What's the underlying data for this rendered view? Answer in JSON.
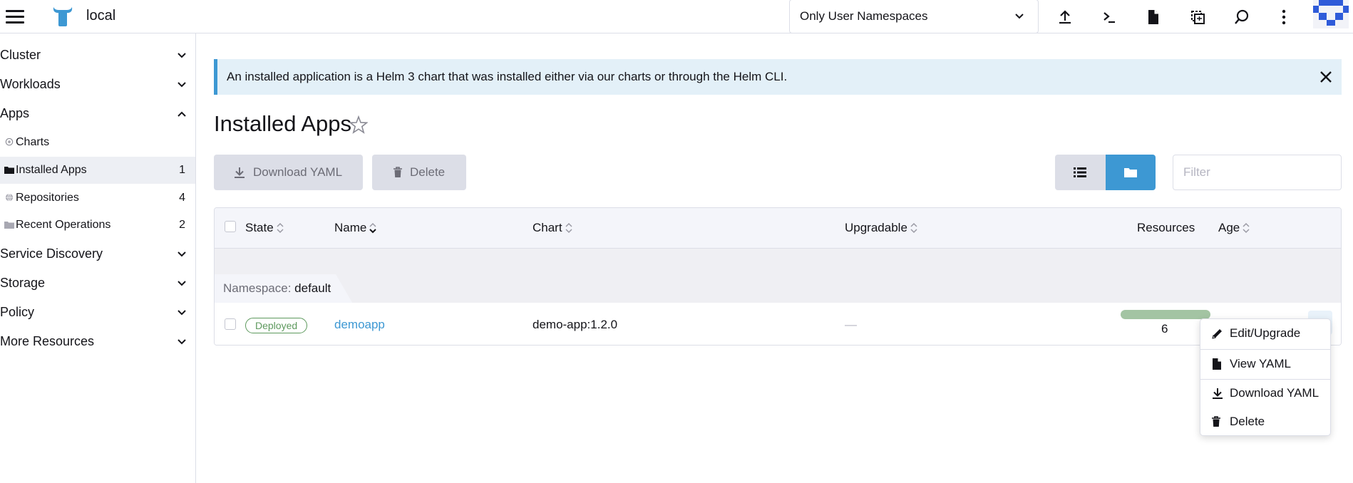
{
  "header": {
    "cluster_name": "local",
    "namespace_filter": "Only User Namespaces"
  },
  "sidebar": {
    "groups": [
      {
        "label": "Cluster"
      },
      {
        "label": "Workloads"
      },
      {
        "label": "Apps"
      },
      {
        "label": "Service Discovery"
      },
      {
        "label": "Storage"
      },
      {
        "label": "Policy"
      },
      {
        "label": "More Resources"
      }
    ],
    "apps_children": [
      {
        "label": "Charts",
        "count": ""
      },
      {
        "label": "Installed Apps",
        "count": "1"
      },
      {
        "label": "Repositories",
        "count": "4"
      },
      {
        "label": "Recent Operations",
        "count": "2"
      }
    ]
  },
  "banner": {
    "text": "An installed application is a Helm 3 chart that was installed either via our charts or through the Helm CLI."
  },
  "page": {
    "title": "Installed Apps",
    "download_yaml_label": "Download YAML",
    "delete_label": "Delete",
    "filter_placeholder": "Filter"
  },
  "table": {
    "columns": {
      "state": "State",
      "name": "Name",
      "chart": "Chart",
      "upgradable": "Upgradable",
      "resources": "Resources",
      "age": "Age"
    },
    "group": {
      "key": "Namespace:",
      "value": "default"
    },
    "rows": [
      {
        "state": "Deployed",
        "name": "demoapp",
        "chart": "demo-app:1.2.0",
        "upgradable": "—",
        "resources": "6"
      }
    ]
  },
  "action_menu": {
    "items": [
      {
        "label": "Edit/Upgrade",
        "icon": "pencil-icon"
      },
      {
        "label": "View YAML",
        "icon": "file-icon"
      },
      {
        "label": "Download YAML",
        "icon": "download-icon"
      },
      {
        "label": "Delete",
        "icon": "trash-icon"
      }
    ]
  },
  "colors": {
    "accent": "#3d98d3",
    "banner_bg": "#e3f0f8",
    "deployed": "#5d995d",
    "resource_bar": "#a3c4a3",
    "disabled_btn": "#dcdee7"
  }
}
